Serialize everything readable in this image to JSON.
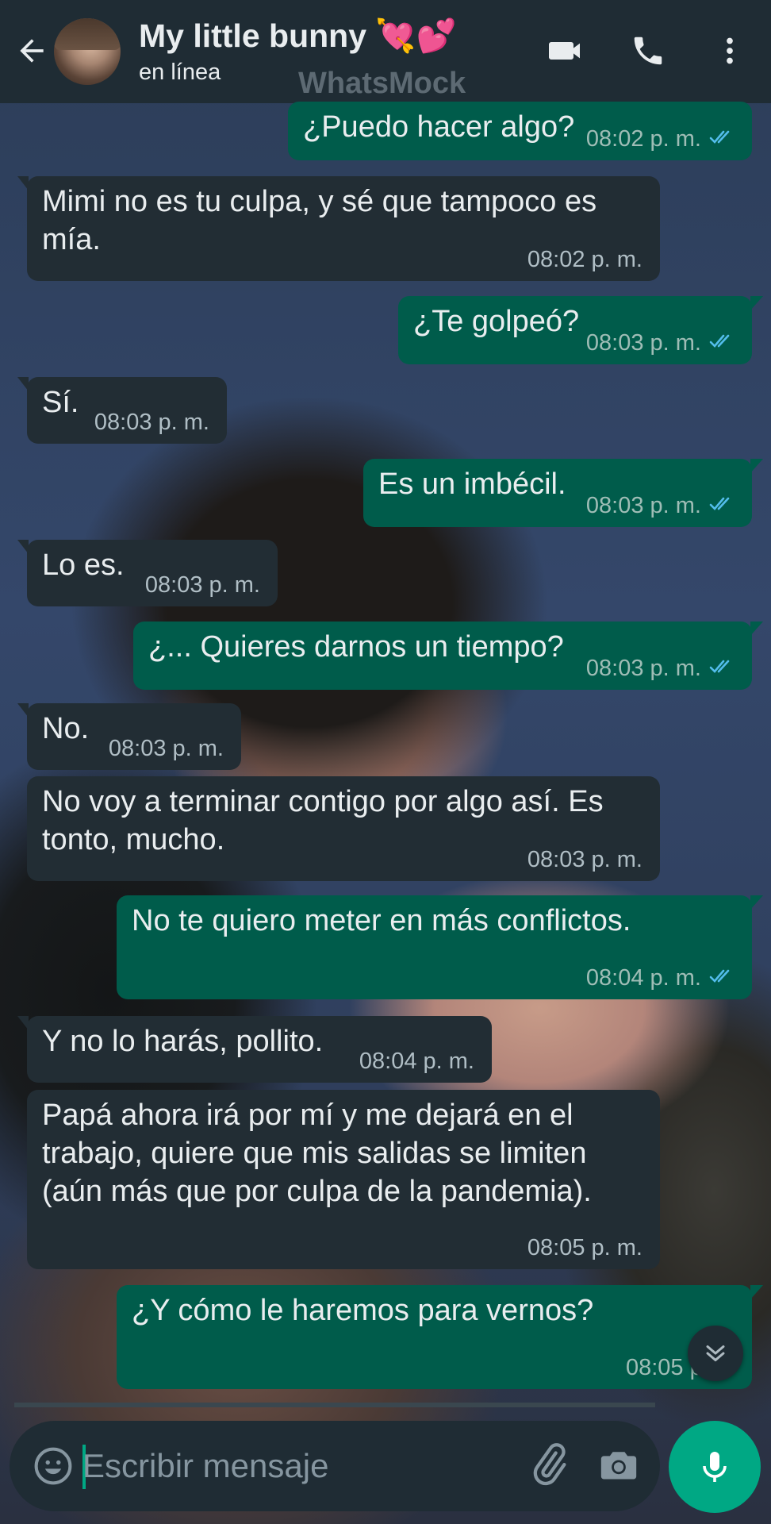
{
  "header": {
    "contact_name": "My little bunny 💘💕",
    "status": "en línea",
    "watermark": "WhatsMock"
  },
  "messages": [
    {
      "dir": "out",
      "text": "¿Puedo hacer algo?",
      "time": "08:02 p. m.",
      "read": true
    },
    {
      "dir": "in",
      "text": "Mimi no es tu culpa, y sé que tampoco es\nmía.",
      "time": "08:02 p. m."
    },
    {
      "dir": "out",
      "text": "¿Te golpeó?",
      "time": "08:03 p. m.",
      "read": true
    },
    {
      "dir": "in",
      "text": "Sí.",
      "time": "08:03 p. m."
    },
    {
      "dir": "out",
      "text": "Es un imbécil.",
      "time": "08:03 p. m.",
      "read": true
    },
    {
      "dir": "in",
      "text": "Lo es.",
      "time": "08:03 p. m."
    },
    {
      "dir": "out",
      "text": "¿... Quieres darnos un tiempo?",
      "time": "08:03 p. m.",
      "read": true
    },
    {
      "dir": "in",
      "text": "No.",
      "time": "08:03 p. m."
    },
    {
      "dir": "in",
      "text": "No voy a terminar contigo por algo así. Es\ntonto, mucho.",
      "time": "08:03 p. m."
    },
    {
      "dir": "out",
      "text": "No te quiero meter en más conflictos.",
      "time": "08:04 p. m.",
      "read": true
    },
    {
      "dir": "in",
      "text": "Y no lo harás, pollito.",
      "time": "08:04 p. m."
    },
    {
      "dir": "in",
      "text": "Papá ahora irá por mí y me dejará en el\ntrabajo, quiere que mis salidas se limiten\n(aún más que por culpa de la pandemia).",
      "time": "08:05 p. m."
    },
    {
      "dir": "out",
      "text": "¿Y cómo le haremos para vernos?",
      "time": "08:05 p. m",
      "read": false
    }
  ],
  "composer": {
    "placeholder": "Escribir mensaje"
  },
  "icons": {
    "back": "arrow-left-icon",
    "video": "video-call-icon",
    "call": "phone-icon",
    "menu": "more-vertical-icon",
    "emoji": "emoji-icon",
    "attach": "paperclip-icon",
    "camera": "camera-icon",
    "mic": "mic-icon",
    "scroll": "chevron-double-down-icon"
  },
  "colors": {
    "header_bg": "#1f2c34",
    "incoming_bubble": "#222d34",
    "outgoing_bubble": "#005c4b",
    "accent": "#00a884",
    "read_ticks": "#53bdeb"
  }
}
